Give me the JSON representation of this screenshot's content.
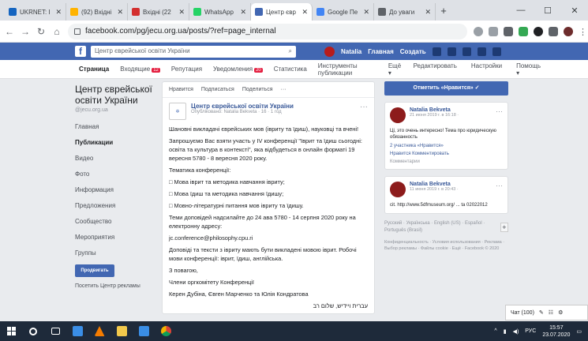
{
  "tabs": [
    {
      "label": "UKRNET: I",
      "color": "#1565c0"
    },
    {
      "label": "(92) Вхідні",
      "color": "#ffb300"
    },
    {
      "label": "Вхідні (22",
      "color": "#d32f2f"
    },
    {
      "label": "WhatsApp",
      "color": "#25d366"
    },
    {
      "label": "Центр євр",
      "color": "#4267b2"
    },
    {
      "label": "Google Пе",
      "color": "#4285f4"
    },
    {
      "label": "До уваги",
      "color": "#5f6368"
    }
  ],
  "window": {
    "minimize": "—",
    "maximize": "☐",
    "close": "✕"
  },
  "address": {
    "url": "facebook.com/pg/jecu.org.ua/posts/?ref=page_internal"
  },
  "fb": {
    "search_placeholder": "Центр єврейської освіти України",
    "user": "Natalia",
    "home": "Главная",
    "create": "Создать"
  },
  "page_tabs": {
    "items": [
      "Страница",
      "Входящие",
      "Репутация",
      "Уведомления",
      "Статистика",
      "Инструменты публикации",
      "Ещё ▾"
    ],
    "inbox_badge": "12",
    "notif_badge": "20",
    "right": [
      "Редактировать",
      "Настройки",
      "Помощь ▾"
    ]
  },
  "sidebar": {
    "page_name": "Центр єврейської освіти України",
    "handle": "@jecu.org.ua",
    "items": [
      "Главная",
      "Публикации",
      "Видео",
      "Фото",
      "Информация",
      "Предложения",
      "Сообщество",
      "Мероприятия",
      "Группы"
    ],
    "selected": 1,
    "promote": "Продвигать",
    "ad_center": "Посетить Центр рекламы"
  },
  "post": {
    "actions": [
      "Нравится",
      "Подписаться",
      "Поделиться",
      "···"
    ],
    "author": "Центр єврейської освіти України",
    "sub": "Опубліковано: Natalia Bekveta · 16 · 1 год",
    "paragraphs": [
      "Шановні викладачі єврейських мов (івриту та їдиш), науковці та вчені!",
      "Запрошуємо Вас взяти участь у IV конференції \"Іврит та їдиш сьогодні: освіта та культура в контексті\", яка відбудеться в онлайн форматі 19 вересня 5780 - 8 вересня 2020 року.",
      "Тематика конференції:",
      "□ Мова іврит та методика навчання івриту;",
      "□ Мова їдиш та методика навчання їдишу;",
      "□ Мовно-літературні питання мов івриту та їдишу.",
      "Теми доповідей надсилайте до 24 ава 5780 - 14 серпня 2020 року на електронну адресу:",
      "jc.conference@philosophy.cpu.ri",
      "Доповіді та тексти з івриту мають бути викладені мовою іврит. Робочі мови конференції: іврит, їдиш, англійська.",
      "З повагою,",
      "Члени оргкомітету Конференції",
      "Керен Дубіна, Євген Марченко та Юлія Кондратова",
      "עברית ויידיש, שלום רב",
      "\"עברית ויידיש\" כנס בינלאומי יתקיים במתכונת מקוונת ב-19 בספטמבר 2020 עבור מורים לעברית ויידיש בכל הגילאים ובכל מסגרת לימוד"
    ]
  },
  "right": {
    "follow_button": "Отметить «Нравится» ✓",
    "card1": {
      "name": "Natalia Bekveta",
      "time": "21 июня 2019 г. в 16:18 ·",
      "text": "Ці, это очень интересно! Тема про юридическую обязанность",
      "links": [
        "2 участника «Нравится»",
        "Нравится   Комментировать"
      ],
      "extra": "Комментарии"
    },
    "card2": {
      "name": "Natalia Bekveta",
      "time": "11 июня 2019 г. в 20:43 ·",
      "text": "cit. http://www.5dfmuseum.org/ ... ta 02022012"
    },
    "languages": "Русский · Українська · English (US) · Español · Português (Brasil)",
    "footer": "Конфиденциальность · Условия использования · Реклама · Выбор рекламы · Файлы cookie · Ещё · Facebook © 2020"
  },
  "chat": {
    "label": "Чат (100)"
  },
  "taskbar": {
    "tray_text": "РУС",
    "time": "15:57",
    "date": "23.07.2020"
  },
  "colors": {
    "fb_blue": "#4267b2",
    "taskbar": "#1e2a3a"
  }
}
